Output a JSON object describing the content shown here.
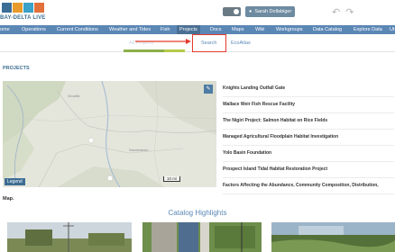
{
  "header": {
    "logo_text": "BAY-DELTA LIVE",
    "user_label": "Sarah Dollabiger",
    "back_icon": "undo-arrow-icon",
    "forward_icon": "redo-arrow-icon"
  },
  "nav": {
    "items": [
      {
        "label": "Home"
      },
      {
        "label": "Operations"
      },
      {
        "label": "Current Conditions"
      },
      {
        "label": "Weather and Tides"
      },
      {
        "label": "Fish"
      },
      {
        "label": "Projects",
        "active": true
      },
      {
        "label": "Docs"
      },
      {
        "label": "Maps"
      },
      {
        "label": "Wiki"
      },
      {
        "label": "Workgroups"
      },
      {
        "label": "Data Catalog"
      },
      {
        "label": "Explore Data"
      },
      {
        "label": "Ut"
      }
    ]
  },
  "subnav": {
    "items": [
      {
        "label": "All Projects"
      },
      {
        "label": "Search"
      },
      {
        "label": "EcoAtlas"
      }
    ]
  },
  "projects": {
    "title": "PROJECTS",
    "map_legend": "Legend",
    "map_scale": "10 mi",
    "items": [
      "Knights Landing Outfall Gate",
      "Wallace Weir Fish Rescue Facility",
      "The Nigiri Project: Salmon Habitat on Rice Fields",
      "Managed Agricultural Floodplain Habitat Investigation",
      "Yolo Basin Foundation",
      "Prospect Island Tidal Habitat Restoration Project",
      "Factors Affecting the Abundance, Community Composition, Distribution,"
    ]
  },
  "map_caption": "Map.",
  "catalog": {
    "title": "Catalog Highlights"
  },
  "colors": {
    "nav_bg": "#5b87b5",
    "nav_active": "#4a6f94",
    "highlight_box": "#e53b2c",
    "title_blue": "#3c6e91"
  }
}
